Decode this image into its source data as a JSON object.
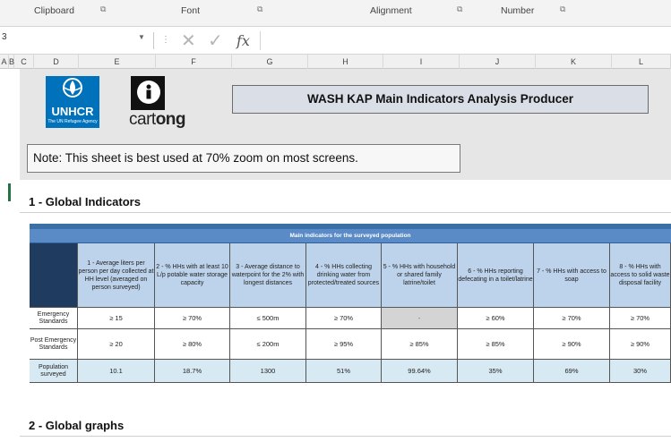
{
  "ribbon": {
    "groups": [
      "Clipboard",
      "Font",
      "Alignment",
      "Number"
    ],
    "launcher_icon": "dialog-launcher-icon"
  },
  "formula_bar": {
    "name_box_value": "3",
    "cancel_icon": "close-icon",
    "enter_icon": "check-icon",
    "fx_label": "fx",
    "formula_value": ""
  },
  "columns": [
    "A",
    "B",
    "C",
    "D",
    "E",
    "F",
    "G",
    "H",
    "I",
    "J",
    "K",
    "L"
  ],
  "logos": {
    "unhcr_name": "UNHCR",
    "unhcr_sub": "The UN Refugee Agency",
    "cartong_word_light": "cart",
    "cartong_word_bold": "ong"
  },
  "title": "WASH KAP Main Indicators Analysis Producer",
  "note": "Note: This sheet is best used at 70% zoom on most screens.",
  "section1": "1 - Global Indicators",
  "section2": "2 - Global graphs",
  "table": {
    "header": "Main indicators for the surveyed population",
    "columns": [
      "1 - Average liters per person per day collected at HH level (averaged on person surveyed)",
      "2 - % HHs with at least 10 L/p potable water storage capacity",
      "3 - Average distance to waterpoint for the 2% with longest distances",
      "4 - % HHs collecting drinking water from protected/treated sources",
      "5 - % HHs with household or shared family latrine/toilet",
      "6 - % HHs reporting defecating in a toilet/latrine",
      "7 - % HHs with access to soap",
      "8 - % HHs with access to solid waste disposal facility"
    ],
    "rows": [
      {
        "label": "Emergency Standards",
        "values": [
          "≥ 15",
          "≥ 70%",
          "≤ 500m",
          "≥ 70%",
          "-",
          "≥ 60%",
          "≥ 70%",
          "≥ 70%"
        ]
      },
      {
        "label": "Post Emergency Standards",
        "values": [
          "≥ 20",
          "≥ 80%",
          "≤ 200m",
          "≥ 95%",
          "≥ 85%",
          "≥ 85%",
          "≥ 90%",
          "≥ 90%"
        ]
      },
      {
        "label": "Population surveyed",
        "values": [
          "10.1",
          "18.7%",
          "1300",
          "51%",
          "99.64%",
          "35%",
          "69%",
          "30%"
        ]
      }
    ]
  },
  "colors": {
    "table_header": "#5a8bc6",
    "column_header_fill": "#bdd3eb",
    "corner_dark": "#1f3b60",
    "population_row": "#d7e9f2",
    "title_fill": "#d9dee7"
  }
}
